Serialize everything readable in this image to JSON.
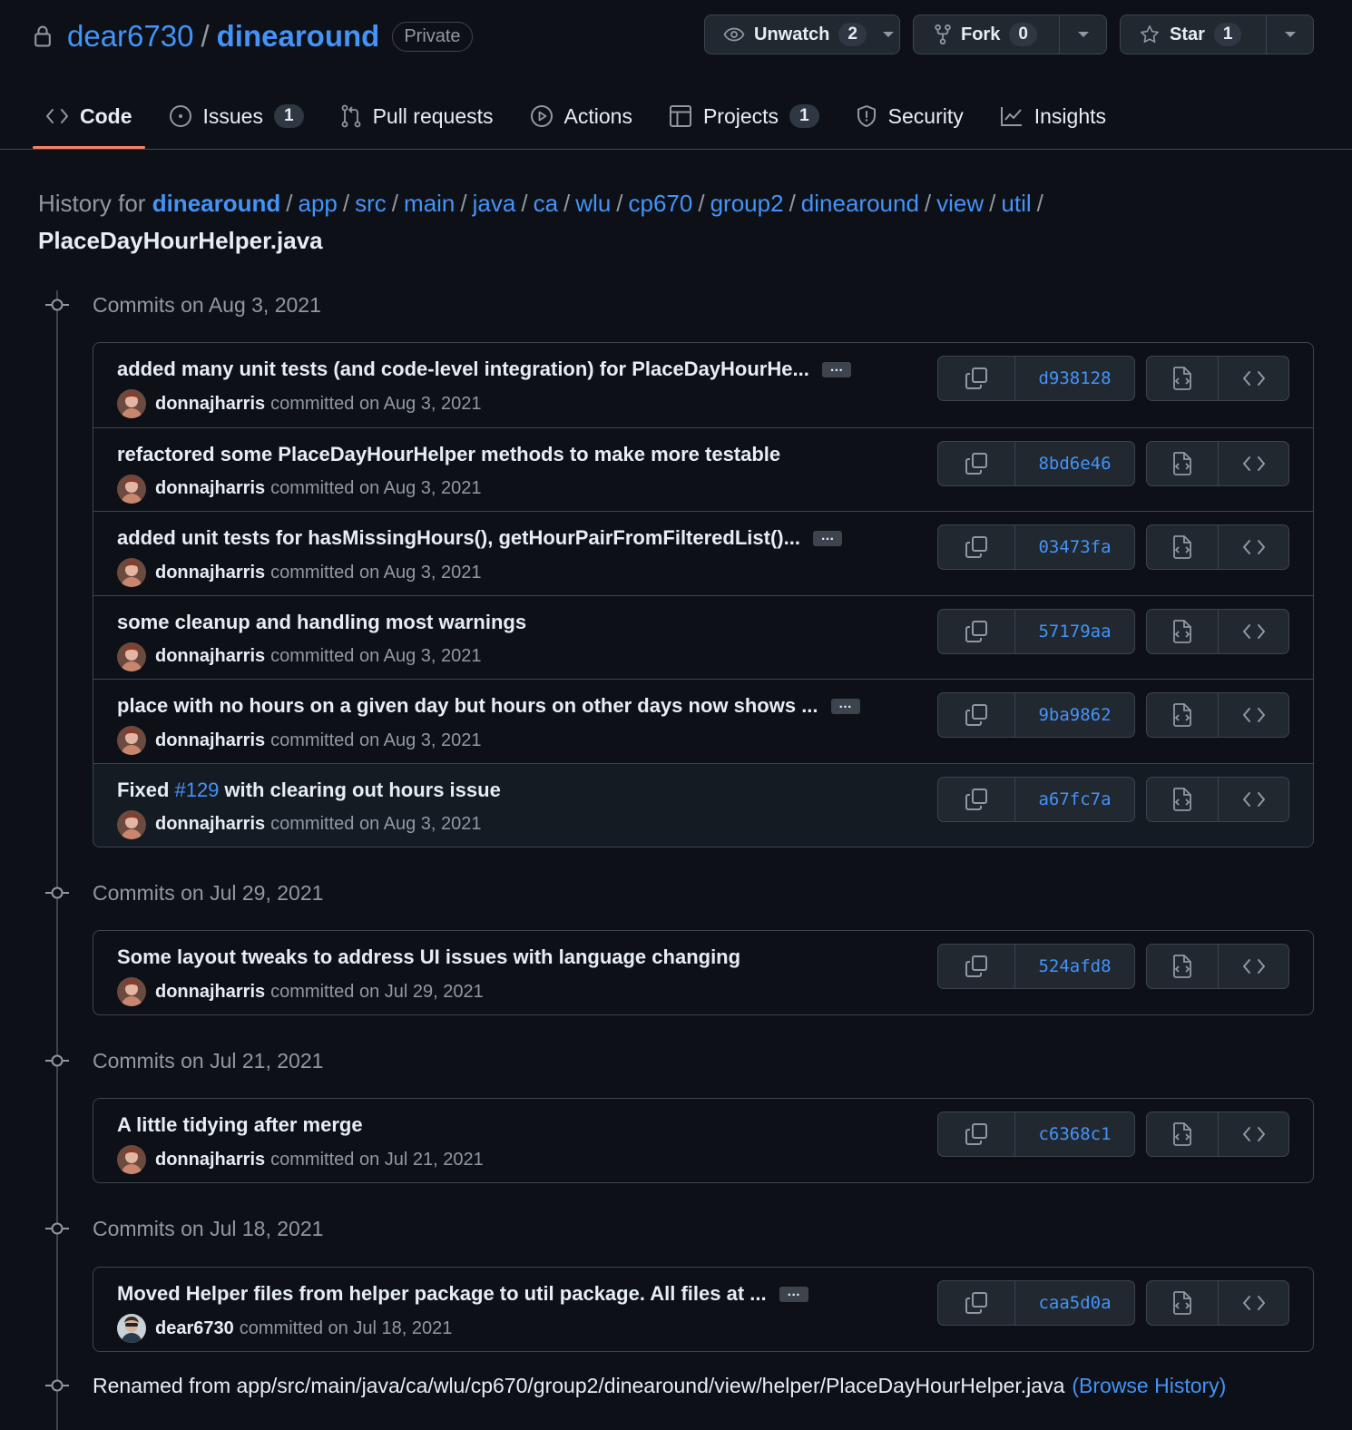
{
  "repo": {
    "owner": "dear6730",
    "separator": "/",
    "name": "dinearound",
    "visibility": "Private"
  },
  "actions": {
    "watch": {
      "label": "Unwatch",
      "count": "2"
    },
    "fork": {
      "label": "Fork",
      "count": "0"
    },
    "star": {
      "label": "Star",
      "count": "1"
    }
  },
  "tabs": [
    {
      "label": "Code",
      "icon": "code-icon",
      "count": null,
      "active": true
    },
    {
      "label": "Issues",
      "icon": "issue-icon",
      "count": "1"
    },
    {
      "label": "Pull requests",
      "icon": "pull-request-icon",
      "count": null
    },
    {
      "label": "Actions",
      "icon": "play-icon",
      "count": null
    },
    {
      "label": "Projects",
      "icon": "table-icon",
      "count": "1"
    },
    {
      "label": "Security",
      "icon": "shield-icon",
      "count": null
    },
    {
      "label": "Insights",
      "icon": "graph-icon",
      "count": null
    }
  ],
  "breadcrumb": {
    "prefix": "History for",
    "root": "dinearound",
    "parts": [
      "app",
      "src",
      "main",
      "java",
      "ca",
      "wlu",
      "cp670",
      "group2",
      "dinearound",
      "view",
      "util"
    ],
    "separator": "/",
    "file": "PlaceDayHourHelper.java"
  },
  "groups": [
    {
      "title": "Commits on Aug 3, 2021",
      "commits": [
        {
          "message": "added many unit tests (and code-level integration) for PlaceDayHourHe...",
          "ellipsis": true,
          "author": "donnajharris",
          "committed": "committed on Aug 3, 2021",
          "sha": "d938128"
        },
        {
          "message": "refactored some PlaceDayHourHelper methods to make more testable",
          "ellipsis": false,
          "author": "donnajharris",
          "committed": "committed on Aug 3, 2021",
          "sha": "8bd6e46"
        },
        {
          "message": "added unit tests for hasMissingHours(), getHourPairFromFilteredList()...",
          "ellipsis": true,
          "author": "donnajharris",
          "committed": "committed on Aug 3, 2021",
          "sha": "03473fa"
        },
        {
          "message": "some cleanup and handling most warnings",
          "ellipsis": false,
          "author": "donnajharris",
          "committed": "committed on Aug 3, 2021",
          "sha": "57179aa"
        },
        {
          "message": "place with no hours on a given day but hours on other days now shows ...",
          "ellipsis": true,
          "author": "donnajharris",
          "committed": "committed on Aug 3, 2021",
          "sha": "9ba9862"
        },
        {
          "message_pre": "Fixed",
          "issue": "#129",
          "message_post": "with clearing out hours issue",
          "ellipsis": false,
          "author": "donnajharris",
          "committed": "committed on Aug 3, 2021",
          "sha": "a67fc7a",
          "highlighted": true
        }
      ]
    },
    {
      "title": "Commits on Jul 29, 2021",
      "commits": [
        {
          "message": "Some layout tweaks to address UI issues with language changing",
          "ellipsis": false,
          "author": "donnajharris",
          "committed": "committed on Jul 29, 2021",
          "sha": "524afd8"
        }
      ]
    },
    {
      "title": "Commits on Jul 21, 2021",
      "commits": [
        {
          "message": "A little tidying after merge",
          "ellipsis": false,
          "author": "donnajharris",
          "committed": "committed on Jul 21, 2021",
          "sha": "c6368c1"
        }
      ]
    },
    {
      "title": "Commits on Jul 18, 2021",
      "commits": [
        {
          "message": "Moved Helper files from helper package to util package. All files at ...",
          "ellipsis": true,
          "author": "dear6730",
          "committed": "committed on Jul 18, 2021",
          "sha": "caa5d0a"
        }
      ]
    }
  ],
  "ellipsis_label": "…",
  "renamed": {
    "text": "Renamed from app/src/main/java/ca/wlu/cp670/group2/dinearound/view/helper/PlaceDayHourHelper.java",
    "link": "(Browse History)"
  },
  "colors": {
    "bg": "#0d1117",
    "link": "#4493f8",
    "muted": "#9198a1",
    "border": "#3d444d",
    "tab_underline": "#f78166"
  }
}
